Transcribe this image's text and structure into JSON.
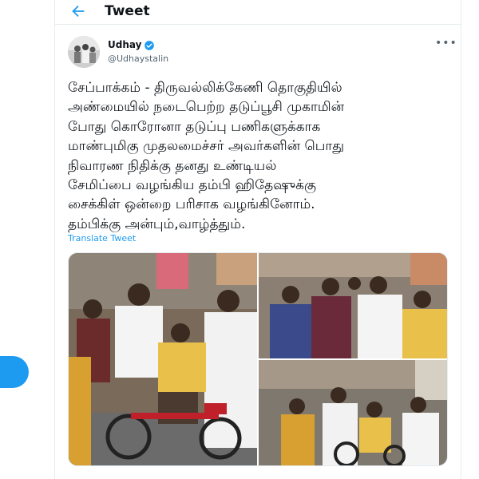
{
  "header": {
    "title": "Tweet"
  },
  "tweet": {
    "author_name": "Udhay",
    "handle": "@Udhaystalin",
    "text": "சேப்பாக்கம் - திருவல்லிக்கேணி தொகுதியில்\nஅண்மையில் நடைபெற்ற தடுப்பூசி முகாமின்\nபோது கொரோனா தடுப்பு பணிகளுக்காக\nமாண்புமிகு முதலமைச்சர் அவர்களின் பொது\nநிவாரண நிதிக்கு தனது உண்டியல்\nசேமிப்பை வழங்கிய தம்பி ஹிதேஷுக்கு\nசைக்கிள் ஒன்றை பரிசாக வழங்கினோம்.\nதம்பிக்கு அன்பும்,வாழ்த்தும்.",
    "translate_label": "Translate Tweet"
  },
  "colors": {
    "accent": "#1d9bf0",
    "secondary_text": "#536471",
    "border": "#e6ecf0"
  },
  "icons": {
    "back": "back-arrow-icon",
    "verified": "verified-badge-icon",
    "more": "more-options-icon"
  }
}
